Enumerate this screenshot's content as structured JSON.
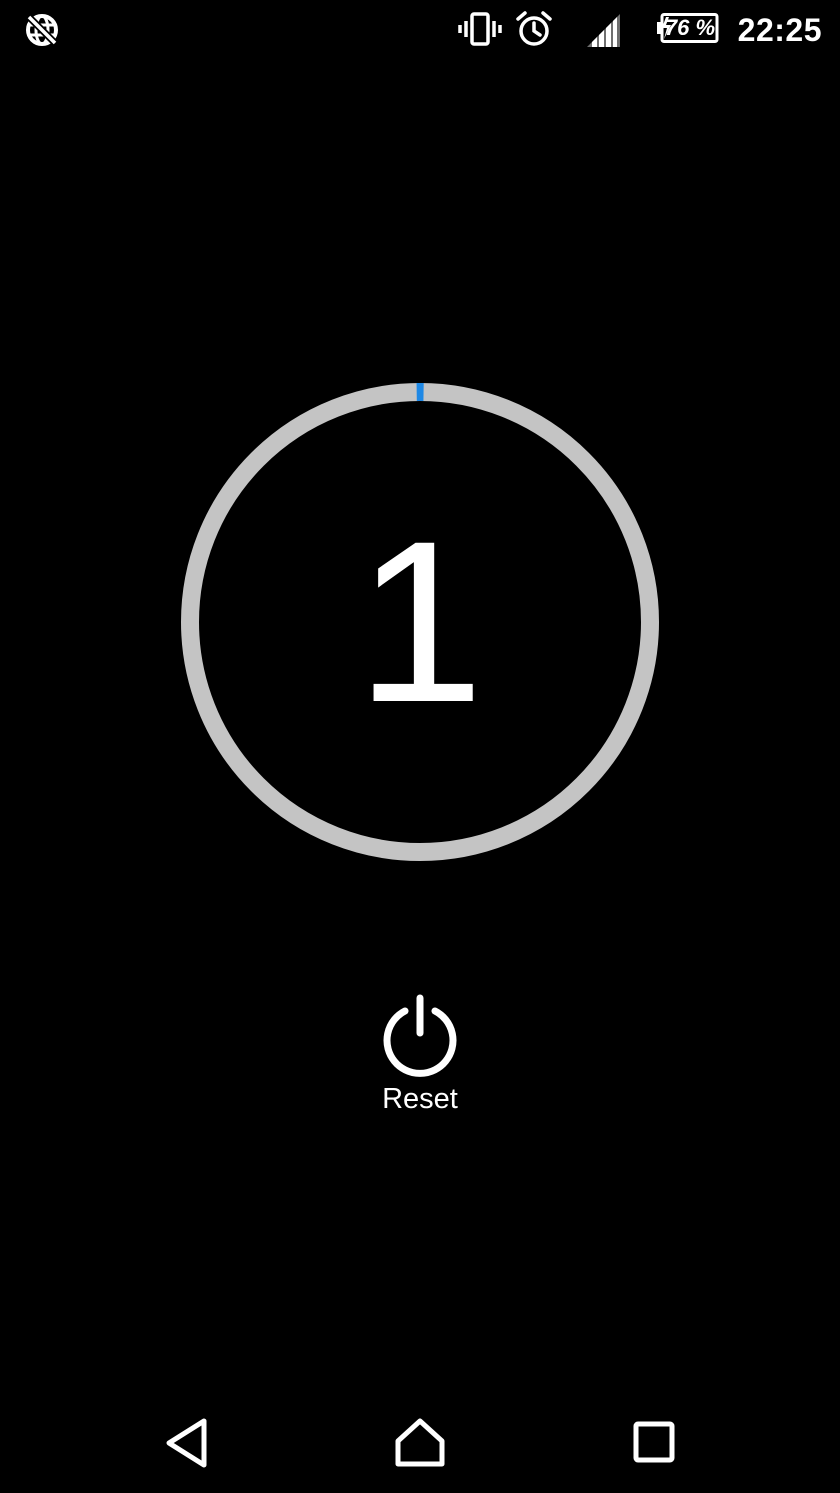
{
  "status_bar": {
    "time": "22:25",
    "battery_percent": "76 %",
    "battery_level": 0.76,
    "icons": [
      "no-data-sync-icon",
      "vibrate-icon",
      "alarm-clock-icon",
      "signal-strength-icon",
      "battery-charging-icon"
    ]
  },
  "counter": {
    "value": "1",
    "progress_fraction": 0.005,
    "ring_color": "#c4c4c4",
    "progress_color": "#1e88e5"
  },
  "reset": {
    "label": "Reset",
    "icon": "power-icon"
  },
  "nav_bar": {
    "icons": [
      "back-icon",
      "home-icon",
      "recents-icon"
    ]
  },
  "colors": {
    "background": "#000000",
    "foreground": "#ffffff"
  }
}
